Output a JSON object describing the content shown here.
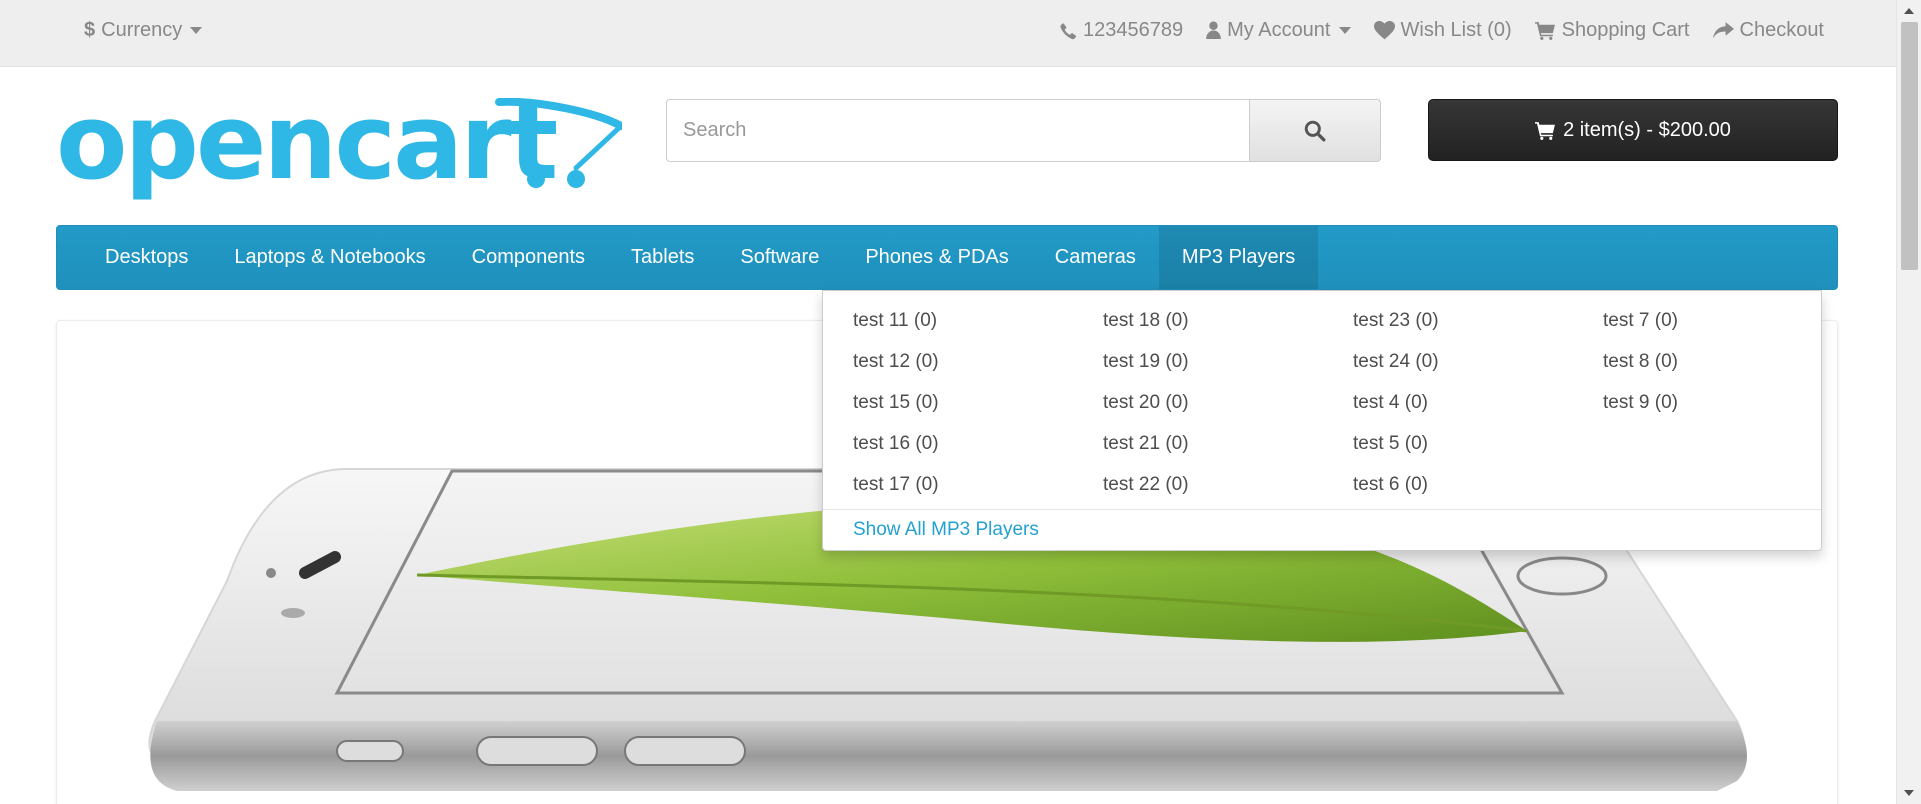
{
  "topbar": {
    "currency_symbol": "$",
    "currency_label": "Currency",
    "phone": "123456789",
    "account": "My Account",
    "wishlist": "Wish List (0)",
    "cart": "Shopping Cart",
    "checkout": "Checkout"
  },
  "logo": {
    "text": "opencart",
    "color": "#2fb7e6"
  },
  "search": {
    "placeholder": "Search"
  },
  "cart_button": {
    "label": "2 item(s) - $200.00"
  },
  "menu": {
    "items": [
      "Desktops",
      "Laptops & Notebooks",
      "Components",
      "Tablets",
      "Software",
      "Phones & PDAs",
      "Cameras",
      "MP3 Players"
    ],
    "active": "MP3 Players",
    "color": "#229ac8"
  },
  "dropdown": {
    "columns": [
      [
        "test 11 (0)",
        "test 12 (0)",
        "test 15 (0)",
        "test 16 (0)",
        "test 17 (0)"
      ],
      [
        "test 18 (0)",
        "test 19 (0)",
        "test 20 (0)",
        "test 21 (0)",
        "test 22 (0)"
      ],
      [
        "test 23 (0)",
        "test 24 (0)",
        "test 4 (0)",
        "test 5 (0)",
        "test 6 (0)"
      ],
      [
        "test 7 (0)",
        "test 8 (0)",
        "test 9 (0)"
      ]
    ],
    "show_all": "Show All MP3 Players",
    "link_color": "#23a1d1"
  }
}
